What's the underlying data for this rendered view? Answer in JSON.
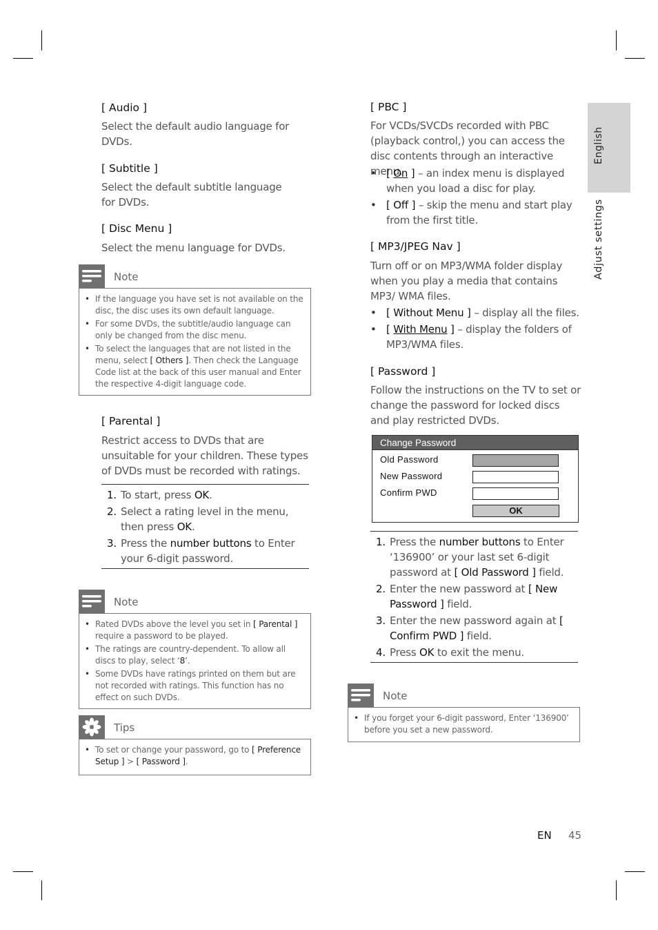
{
  "side_tabs": {
    "language": "English",
    "section": "Adjust settings"
  },
  "left": {
    "audio": {
      "heading": "[ Audio ]",
      "text": "Select the default audio language for DVDs."
    },
    "subtitle": {
      "heading": "[ Subtitle ]",
      "text": "Select the default subtitle language for DVDs."
    },
    "disc_menu": {
      "heading": "[ Disc Menu ]",
      "text": "Select the menu language for DVDs."
    },
    "note1": {
      "title": "Note",
      "items": [
        {
          "text": "If the language you have set is not available on the disc, the disc uses its own default language."
        },
        {
          "text": "For some DVDs, the subtitle/audio language can only be changed from the disc menu."
        },
        {
          "pre": "To select the languages that are not listed in the menu, select ",
          "bold": "[ Others ]",
          "post": ".  Then check the Language Code list at the back of this user manual and Enter the respective 4-digit language code."
        }
      ]
    },
    "parental": {
      "heading": "[ Parental ]",
      "text": "Restrict access to DVDs that are unsuitable for your children.  These types of DVDs must be recorded with ratings.",
      "steps": [
        {
          "num": "1.",
          "pre": "To start, press ",
          "bold": "OK",
          "post": "."
        },
        {
          "num": "2.",
          "pre": "Select a rating level in the menu, then press ",
          "bold": "OK",
          "post": "."
        },
        {
          "num": "3.",
          "pre": "Press the ",
          "bold": "number buttons",
          "post": " to Enter your 6-digit password."
        }
      ]
    },
    "note2": {
      "title": "Note",
      "items": [
        {
          "pre": "Rated DVDs above the level you set in ",
          "bold": "[ Parental ]",
          "post": " require a password to be played."
        },
        {
          "pre": "The ratings are country-dependent. To allow all discs to play, select ‘",
          "bold": "8",
          "post": "’."
        },
        {
          "pre": "Some DVDs have ratings printed on them but are not recorded with ratings.  This function has no effect on such DVDs.",
          "bold": "",
          "post": ""
        }
      ]
    },
    "tips": {
      "title": "Tips",
      "pre": "To set or change your password, go to ",
      "bold1": "[ Preference Setup ]",
      "mid": " > ",
      "bold2": "[ Password ]",
      "post": "."
    }
  },
  "right": {
    "pbc": {
      "heading": "[ PBC ]",
      "text": "For VCDs/SVCDs recorded with PBC (playback control,) you can access the disc contents through an interactive menu.",
      "options": [
        {
          "open": "[ ",
          "label": "On",
          "close": " ]",
          "underline": true,
          "desc": " – an index menu is displayed when you load a disc for play."
        },
        {
          "open": "[ ",
          "label": "Off",
          "close": " ]",
          "underline": false,
          "desc": " – skip the menu and start play from the first title."
        }
      ]
    },
    "mp3nav": {
      "heading": "[ MP3/JPEG Nav ]",
      "text": "Turn off or on MP3/WMA folder display when you play a media that contains MP3/ WMA files.",
      "options": [
        {
          "open": "[ ",
          "label": "Without Menu",
          "close": " ]",
          "underline": false,
          "desc": " – display all the files."
        },
        {
          "open": "[ ",
          "label": "With Menu",
          "close": " ]",
          "underline": true,
          "desc": " – display the folders of MP3/WMA files."
        }
      ]
    },
    "password": {
      "heading": "[ Password ]",
      "text": "Follow the instructions on the TV to set or change the password for locked discs and play restricted DVDs."
    },
    "dialog": {
      "title": "Change Password",
      "old_label": "Old Password",
      "new_label": "New Password",
      "confirm_label": "Confirm PWD",
      "ok_label": "OK"
    },
    "steps": [
      {
        "num": "1.",
        "pre": "Press the ",
        "bold": "number buttons",
        "mid": " to Enter ‘136900’ or your last set 6-digit password at ",
        "bold2": "[ Old Password ]",
        "post": " field."
      },
      {
        "num": "2.",
        "pre": "Enter the new password at ",
        "bold": "[ New Password ]",
        "mid": "",
        "bold2": "",
        "post": " field."
      },
      {
        "num": "3.",
        "pre": "Enter the new password again at ",
        "bold": "[ Confirm PWD ]",
        "mid": "",
        "bold2": "",
        "post": " field."
      },
      {
        "num": "4.",
        "pre": "Press ",
        "bold": "OK",
        "mid": "",
        "bold2": "",
        "post": " to exit the menu."
      }
    ],
    "note3": {
      "title": "Note",
      "text": "If you forget your 6-digit password, Enter ‘136900’ before you set a new password."
    }
  },
  "footer": {
    "lang": "EN",
    "page": "45"
  }
}
